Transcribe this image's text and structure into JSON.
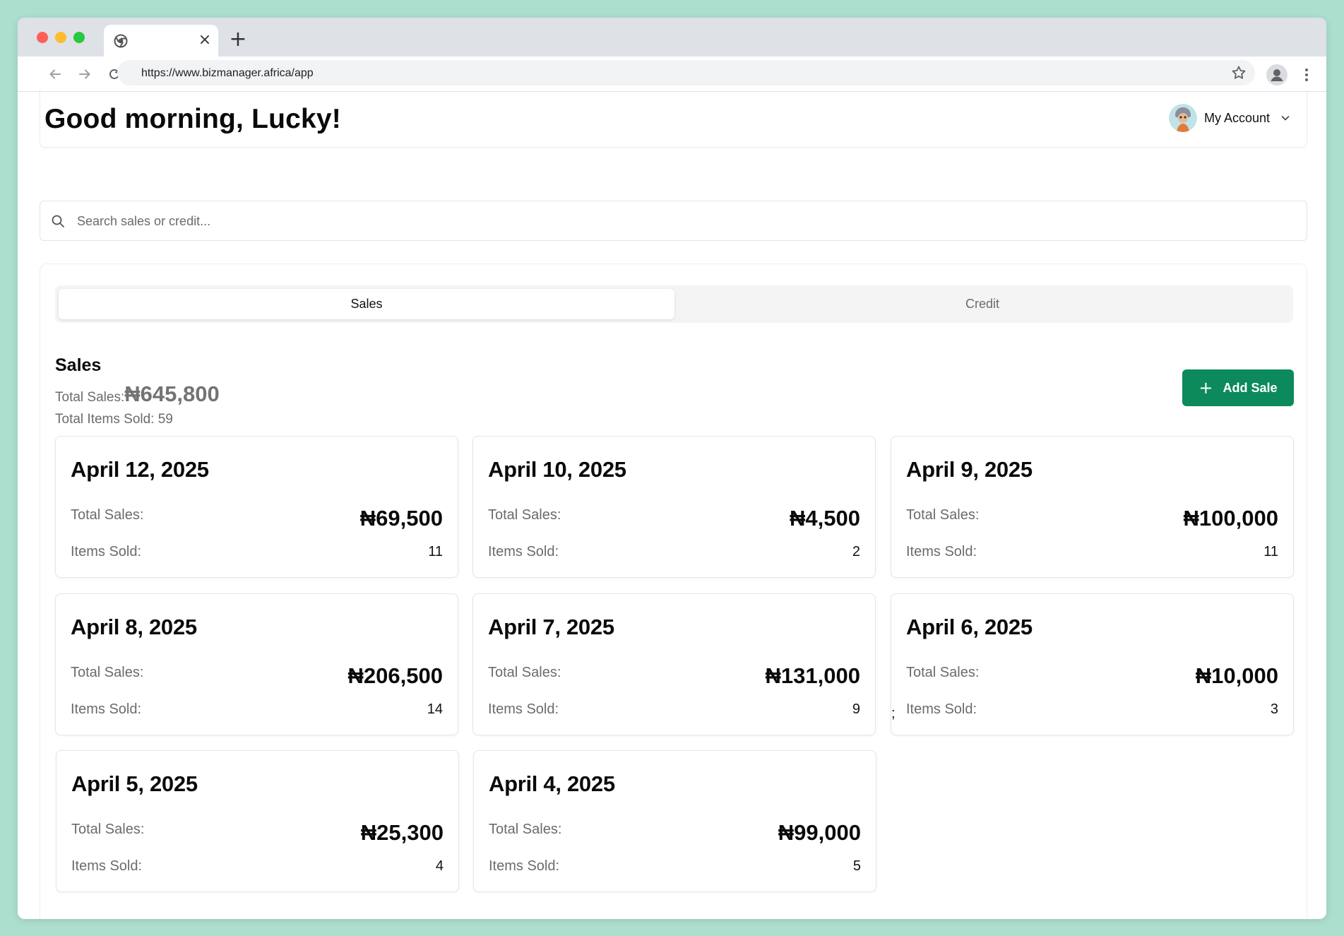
{
  "browser": {
    "url": "https://www.bizmanager.africa/app"
  },
  "header": {
    "greeting": "Good morning, Lucky!",
    "account_label": "My Account"
  },
  "search": {
    "placeholder": "Search sales or credit..."
  },
  "tabs": [
    {
      "label": "Sales",
      "active": true
    },
    {
      "label": "Credit",
      "active": false
    }
  ],
  "sales": {
    "title": "Sales",
    "total_sales_label": "Total Sales:",
    "total_sales_value": "₦645,800",
    "total_items_text": "Total Items Sold: 59",
    "add_button_label": "Add Sale",
    "stray_text": ";"
  },
  "labels": {
    "total_sales": "Total Sales:",
    "items_sold": "Items Sold:"
  },
  "days": [
    {
      "date": "April 12, 2025",
      "total_sales": "₦69,500",
      "items_sold": "11"
    },
    {
      "date": "April 10, 2025",
      "total_sales": "₦4,500",
      "items_sold": "2"
    },
    {
      "date": "April 9, 2025",
      "total_sales": "₦100,000",
      "items_sold": "11"
    },
    {
      "date": "April 8, 2025",
      "total_sales": "₦206,500",
      "items_sold": "14"
    },
    {
      "date": "April 7, 2025",
      "total_sales": "₦131,000",
      "items_sold": "9"
    },
    {
      "date": "April 6, 2025",
      "total_sales": "₦10,000",
      "items_sold": "3"
    },
    {
      "date": "April 5, 2025",
      "total_sales": "₦25,300",
      "items_sold": "4"
    },
    {
      "date": "April 4, 2025",
      "total_sales": "₦99,000",
      "items_sold": "5"
    }
  ],
  "colors": {
    "accent": "#0c8a5b",
    "background": "#addfcf"
  }
}
